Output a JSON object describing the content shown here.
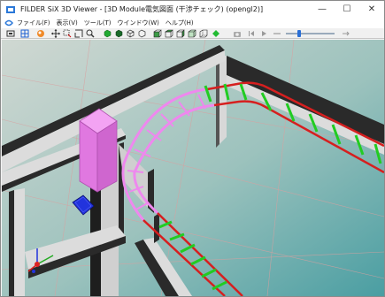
{
  "window": {
    "title": "FILDER SiX 3D Viewer - [3D Module電気図面 (干渉チェック) (opengl2)]",
    "minimize_label": "—",
    "maximize_label": "☐",
    "close_label": "✕"
  },
  "menu": {
    "items": [
      "ファイル(F)",
      "表示(V)",
      "ツール(T)",
      "ウインドウ(W)",
      "ヘルプ(H)"
    ]
  },
  "toolbar": {
    "buttons": [
      "open-icon",
      "grid-icon",
      "render-icon",
      "pan-icon",
      "zoom-window-icon",
      "zoom-fit-icon",
      "zoom-icon",
      "solid-green-icon",
      "solid-dark-icon",
      "wire-icon",
      "outline-icon",
      "view-front-icon",
      "view-top-icon",
      "view-side-icon",
      "view-iso-icon",
      "view-back-icon",
      "shade-icon",
      "camera-icon",
      "first-frame-icon",
      "play-icon",
      "slider-icon",
      "arrow-right-icon"
    ],
    "slider_value": 0.25
  },
  "colors": {
    "background_top": "#c8d2cc",
    "background_bottom": "#5fa8a8",
    "wall_dark": "#2a2a2a",
    "wall_light": "#d9d9d9",
    "cable_tray": "#d61f1f",
    "rung": "#22cc22",
    "pink_component": "#ee88ee",
    "blue_panel": "#2233dd"
  }
}
